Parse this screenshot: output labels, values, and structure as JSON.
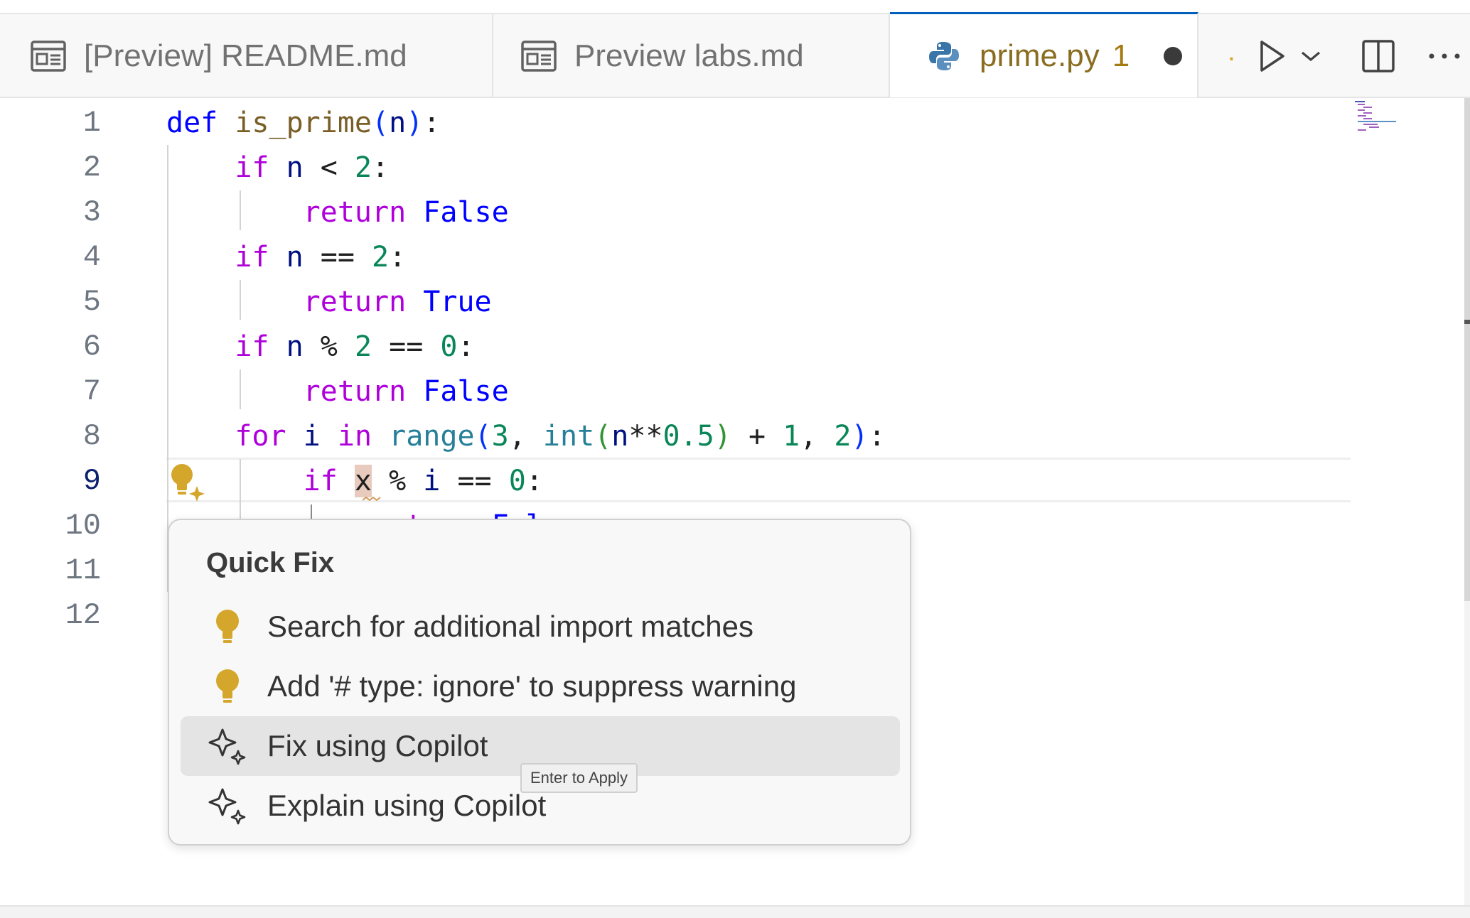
{
  "tabs": [
    {
      "label": "[Preview] README.md",
      "icon": "preview-icon",
      "active": false
    },
    {
      "label": "Preview labs.md",
      "icon": "preview-icon",
      "active": false
    },
    {
      "label": "prime.py",
      "problem_count": "1",
      "icon": "python-icon",
      "active": true,
      "dirty": true
    }
  ],
  "tab_overflow_marker": ".",
  "colors": {
    "accent": "#005fb8",
    "active_tab_text": "#8a6d20",
    "lightbulb": "#d4a72c"
  },
  "editor": {
    "line_numbers": [
      "1",
      "2",
      "3",
      "4",
      "5",
      "6",
      "7",
      "8",
      "9",
      "10",
      "11",
      "12"
    ],
    "current_line": "9",
    "lines": [
      [
        {
          "t": "def",
          "c": "kwd"
        },
        {
          "t": " ",
          "c": ""
        },
        {
          "t": "is_prime",
          "c": "fn"
        },
        {
          "t": "(",
          "c": "p1"
        },
        {
          "t": "n",
          "c": "var"
        },
        {
          "t": ")",
          "c": "p1"
        },
        {
          "t": ":",
          "c": ""
        }
      ],
      [
        {
          "t": "    ",
          "c": ""
        },
        {
          "t": "if",
          "c": "kw"
        },
        {
          "t": " ",
          "c": ""
        },
        {
          "t": "n",
          "c": "var"
        },
        {
          "t": " < ",
          "c": ""
        },
        {
          "t": "2",
          "c": "num"
        },
        {
          "t": ":",
          "c": ""
        }
      ],
      [
        {
          "t": "        ",
          "c": ""
        },
        {
          "t": "return",
          "c": "kw"
        },
        {
          "t": " ",
          "c": ""
        },
        {
          "t": "False",
          "c": "kwd"
        }
      ],
      [
        {
          "t": "    ",
          "c": ""
        },
        {
          "t": "if",
          "c": "kw"
        },
        {
          "t": " ",
          "c": ""
        },
        {
          "t": "n",
          "c": "var"
        },
        {
          "t": " == ",
          "c": ""
        },
        {
          "t": "2",
          "c": "num"
        },
        {
          "t": ":",
          "c": ""
        }
      ],
      [
        {
          "t": "        ",
          "c": ""
        },
        {
          "t": "return",
          "c": "kw"
        },
        {
          "t": " ",
          "c": ""
        },
        {
          "t": "True",
          "c": "kwd"
        }
      ],
      [
        {
          "t": "    ",
          "c": ""
        },
        {
          "t": "if",
          "c": "kw"
        },
        {
          "t": " ",
          "c": ""
        },
        {
          "t": "n",
          "c": "var"
        },
        {
          "t": " % ",
          "c": ""
        },
        {
          "t": "2",
          "c": "num"
        },
        {
          "t": " == ",
          "c": ""
        },
        {
          "t": "0",
          "c": "num"
        },
        {
          "t": ":",
          "c": ""
        }
      ],
      [
        {
          "t": "        ",
          "c": ""
        },
        {
          "t": "return",
          "c": "kw"
        },
        {
          "t": " ",
          "c": ""
        },
        {
          "t": "False",
          "c": "kwd"
        }
      ],
      [
        {
          "t": "    ",
          "c": ""
        },
        {
          "t": "for",
          "c": "kw"
        },
        {
          "t": " ",
          "c": ""
        },
        {
          "t": "i",
          "c": "var"
        },
        {
          "t": " ",
          "c": ""
        },
        {
          "t": "in",
          "c": "kw"
        },
        {
          "t": " ",
          "c": ""
        },
        {
          "t": "range",
          "c": "builtin"
        },
        {
          "t": "(",
          "c": "p1"
        },
        {
          "t": "3",
          "c": "num"
        },
        {
          "t": ", ",
          "c": ""
        },
        {
          "t": "int",
          "c": "builtin"
        },
        {
          "t": "(",
          "c": "p2"
        },
        {
          "t": "n",
          "c": "var"
        },
        {
          "t": "**",
          "c": ""
        },
        {
          "t": "0.5",
          "c": "num"
        },
        {
          "t": ")",
          "c": "p2"
        },
        {
          "t": " + ",
          "c": ""
        },
        {
          "t": "1",
          "c": "num"
        },
        {
          "t": ", ",
          "c": ""
        },
        {
          "t": "2",
          "c": "num"
        },
        {
          "t": ")",
          "c": "p1"
        },
        {
          "t": ":",
          "c": ""
        }
      ],
      [
        {
          "t": "        ",
          "c": ""
        },
        {
          "t": "if",
          "c": "kw"
        },
        {
          "t": " ",
          "c": ""
        },
        {
          "t": "x",
          "c": "error-char"
        },
        {
          "t": " % ",
          "c": ""
        },
        {
          "t": "i",
          "c": "var"
        },
        {
          "t": " == ",
          "c": ""
        },
        {
          "t": "0",
          "c": "num"
        },
        {
          "t": ":",
          "c": ""
        }
      ],
      [
        {
          "t": "            ",
          "c": ""
        },
        {
          "t": "return",
          "c": "kw"
        },
        {
          "t": " ",
          "c": ""
        },
        {
          "t": "False",
          "c": "kwd"
        }
      ],
      [],
      []
    ]
  },
  "quick_fix": {
    "title": "Quick Fix",
    "items": [
      {
        "label": "Search for additional import matches",
        "icon": "lightbulb-icon",
        "selected": false
      },
      {
        "label": "Add '# type: ignore' to suppress warning",
        "icon": "lightbulb-icon",
        "selected": false
      },
      {
        "label": "Fix using Copilot",
        "icon": "sparkle-icon",
        "selected": true
      },
      {
        "label": "Explain using Copilot",
        "icon": "sparkle-icon",
        "selected": false
      }
    ],
    "tooltip": "Enter to Apply"
  }
}
